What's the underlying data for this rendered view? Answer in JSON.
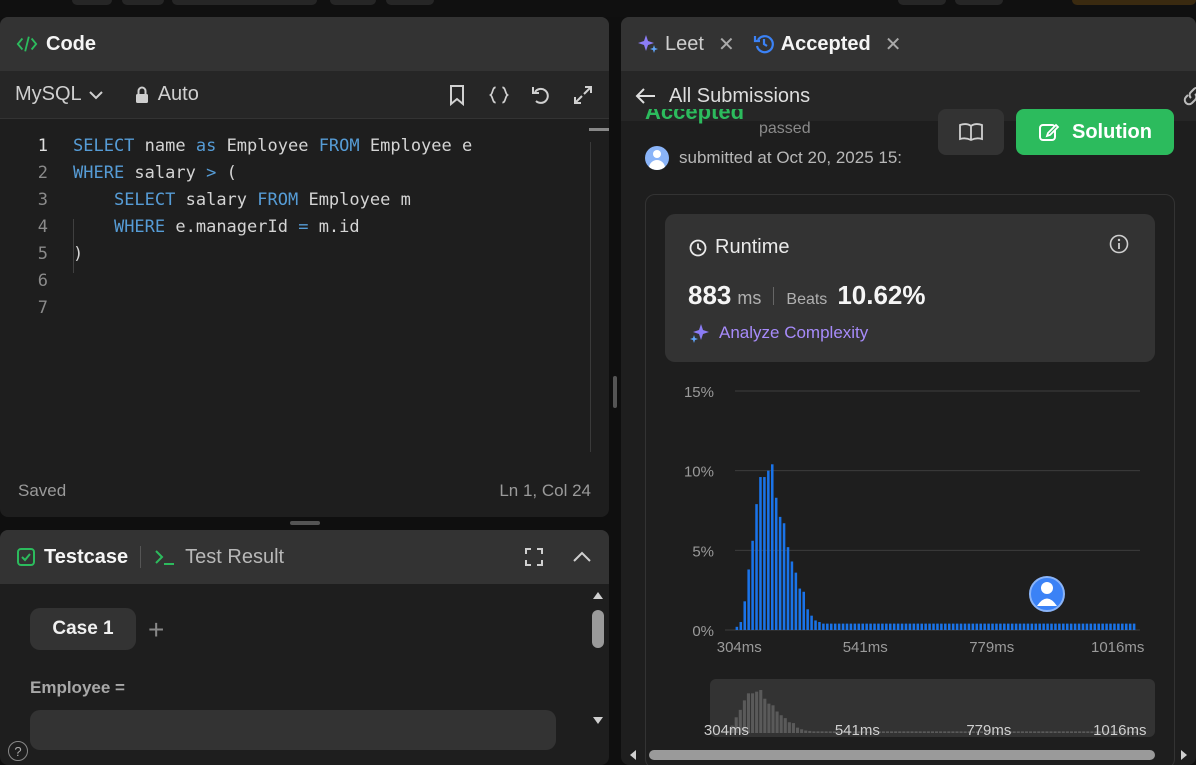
{
  "code_panel": {
    "title": "Code",
    "language": "MySQL",
    "mode": "Auto",
    "lines": [
      {
        "n": "1",
        "tokens": [
          [
            "kw",
            "SELECT"
          ],
          [
            "t",
            " name "
          ],
          [
            "kw",
            "as"
          ],
          [
            "t",
            " Employee "
          ],
          [
            "kw",
            "FROM"
          ],
          [
            "t",
            " Employee e"
          ]
        ]
      },
      {
        "n": "2",
        "tokens": [
          [
            "kw",
            "WHERE"
          ],
          [
            "t",
            " salary "
          ],
          [
            "kw",
            ">"
          ],
          [
            "t",
            " ("
          ]
        ]
      },
      {
        "n": "3",
        "tokens": [
          [
            "t",
            "    "
          ],
          [
            "kw",
            "SELECT"
          ],
          [
            "t",
            " salary "
          ],
          [
            "kw",
            "FROM"
          ],
          [
            "t",
            " Employee m"
          ]
        ]
      },
      {
        "n": "4",
        "tokens": [
          [
            "t",
            "    "
          ],
          [
            "kw",
            "WHERE"
          ],
          [
            "t",
            " e.managerId "
          ],
          [
            "kw",
            "="
          ],
          [
            "t",
            " m.id"
          ]
        ]
      },
      {
        "n": "5",
        "tokens": [
          [
            "t",
            ")"
          ]
        ]
      },
      {
        "n": "6",
        "tokens": []
      },
      {
        "n": "7",
        "tokens": []
      }
    ],
    "status_left": "Saved",
    "status_right": "Ln 1, Col 24"
  },
  "testcase_panel": {
    "tab_testcase": "Testcase",
    "tab_result": "Test Result",
    "case_label": "Case 1",
    "add_symbol": "+",
    "employee_label": "Employee ="
  },
  "help_symbol": "?",
  "result_panel": {
    "tab_leet": "Leet",
    "tab_accepted": "Accepted",
    "close_symbol": "✕",
    "back_label": "All Submissions",
    "status": "Accepted",
    "passed": "passed",
    "submitted": "submitted at Oct 20, 2025 15:",
    "solution_label": "Solution",
    "runtime": {
      "title": "Runtime",
      "value": "883",
      "unit": "ms",
      "beats_label": "Beats",
      "beats_value": "10.62%",
      "analyze_label": "Analyze Complexity"
    }
  },
  "colors": {
    "accent_green": "#2cbb5d",
    "bar_blue": "#1a73e8",
    "analyze_purple": "#a78bfa",
    "keyword_blue": "#569cd6"
  },
  "chart_data": {
    "type": "bar",
    "ylabel": "",
    "xlabel": "",
    "ylim": [
      0,
      15
    ],
    "y_ticks": [
      "15%",
      "10%",
      "5%",
      "0%"
    ],
    "y_tick_values": [
      15,
      10,
      5,
      0
    ],
    "x_tick_labels": [
      "304ms",
      "541ms",
      "779ms",
      "1016ms"
    ],
    "x_tick_values": [
      304,
      541,
      779,
      1016
    ],
    "xlim": [
      296,
      1058
    ],
    "bin_width_ms": 7.4,
    "values": [
      0.2,
      0.5,
      1.8,
      3.8,
      5.6,
      7.9,
      9.6,
      9.6,
      10.0,
      10.4,
      8.3,
      7.1,
      6.7,
      5.2,
      4.3,
      3.6,
      2.6,
      2.4,
      1.3,
      0.9,
      0.6,
      0.5,
      0.4,
      0.4,
      0.4,
      0.4,
      0.4,
      0.4,
      0.4,
      0.4,
      0.4,
      0.4,
      0.4,
      0.4,
      0.4,
      0.4,
      0.4,
      0.4,
      0.4,
      0.4,
      0.4,
      0.4,
      0.4,
      0.4,
      0.4,
      0.4,
      0.4,
      0.4,
      0.4,
      0.4,
      0.4,
      0.4,
      0.4,
      0.4,
      0.4,
      0.4,
      0.4,
      0.4,
      0.4,
      0.4,
      0.4,
      0.4,
      0.4,
      0.4,
      0.4,
      0.4,
      0.4,
      0.4,
      0.4,
      0.4,
      0.4,
      0.4,
      0.4,
      0.4,
      0.4,
      0.4,
      0.4,
      0.4,
      0.4,
      0.4,
      0.4,
      0.4,
      0.4,
      0.4,
      0.4,
      0.4,
      0.4,
      0.4,
      0.4,
      0.4,
      0.4,
      0.4,
      0.4,
      0.4,
      0.4,
      0.4,
      0.4,
      0.4,
      0.4,
      0.4,
      0.4,
      0.4
    ],
    "marker_x_ms": 883,
    "grid": true
  }
}
